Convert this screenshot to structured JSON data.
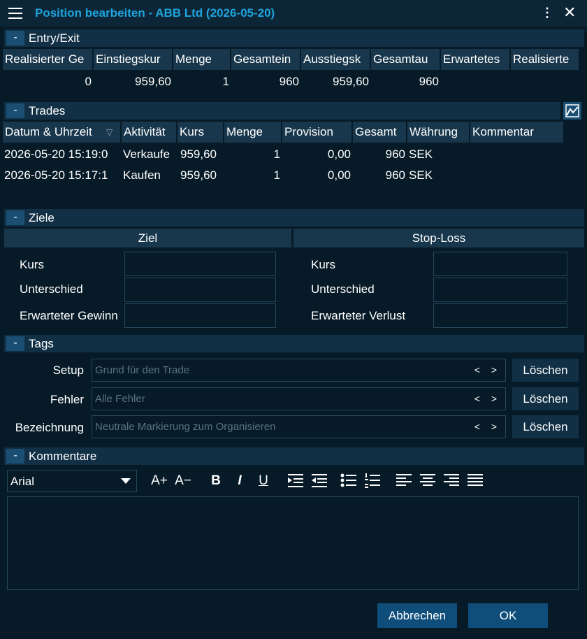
{
  "window": {
    "title": "Position bearbeiten - ABB Ltd (2026-05-20)"
  },
  "sections": {
    "entry_exit": "Entry/Exit",
    "trades": "Trades",
    "ziele": "Ziele",
    "tags": "Tags",
    "kommentare": "Kommentare",
    "toggle": "-"
  },
  "entry_exit": {
    "headers": [
      "Realisierter Ge",
      "Einstiegskur",
      "Menge",
      "Gesamtein",
      "Ausstiegsk",
      "Gesamtau",
      "Erwartetes",
      "Realisierte"
    ],
    "values": [
      "0",
      "959,60",
      "1",
      "960",
      "959,60",
      "960",
      "",
      ""
    ]
  },
  "trades": {
    "headers": [
      "Datum & Uhrzeit",
      "Aktivität",
      "Kurs",
      "Menge",
      "Provision",
      "Gesamt",
      "Währung",
      "Kommentar"
    ],
    "sort_icon": "▽",
    "rows": [
      [
        "2026-05-20 15:19:0",
        "Verkaufe",
        "959,60",
        "1",
        "0,00",
        "960",
        "SEK",
        ""
      ],
      [
        "2026-05-20 15:17:1",
        "Kaufen",
        "959,60",
        "1",
        "0,00",
        "960",
        "SEK",
        ""
      ]
    ]
  },
  "ziele": {
    "col_ziel": "Ziel",
    "col_stop": "Stop-Loss",
    "left": {
      "kurs": "Kurs",
      "unterschied": "Unterschied",
      "gewinn": "Erwarteter Gewinn"
    },
    "right": {
      "kurs": "Kurs",
      "unterschied": "Unterschied",
      "verlust": "Erwarteter Verlust"
    }
  },
  "tags": {
    "arrows": "< >",
    "clear_label": "Löschen",
    "items": [
      {
        "label": "Setup",
        "placeholder": "Grund für den Trade"
      },
      {
        "label": "Fehler",
        "placeholder": "Alle Fehler"
      },
      {
        "label": "Bezeichnung",
        "placeholder": "Neutrale Markierung zum Organisieren"
      }
    ]
  },
  "editor": {
    "font": "Arial",
    "icons": [
      "A+",
      "A−",
      "B",
      "I",
      "U"
    ]
  },
  "footer": {
    "cancel": "Abbrechen",
    "ok": "OK"
  },
  "colors": {
    "background": "#061a27",
    "title": "#1fa4dd",
    "header": "#18374c",
    "button": "#0f4e7a"
  }
}
